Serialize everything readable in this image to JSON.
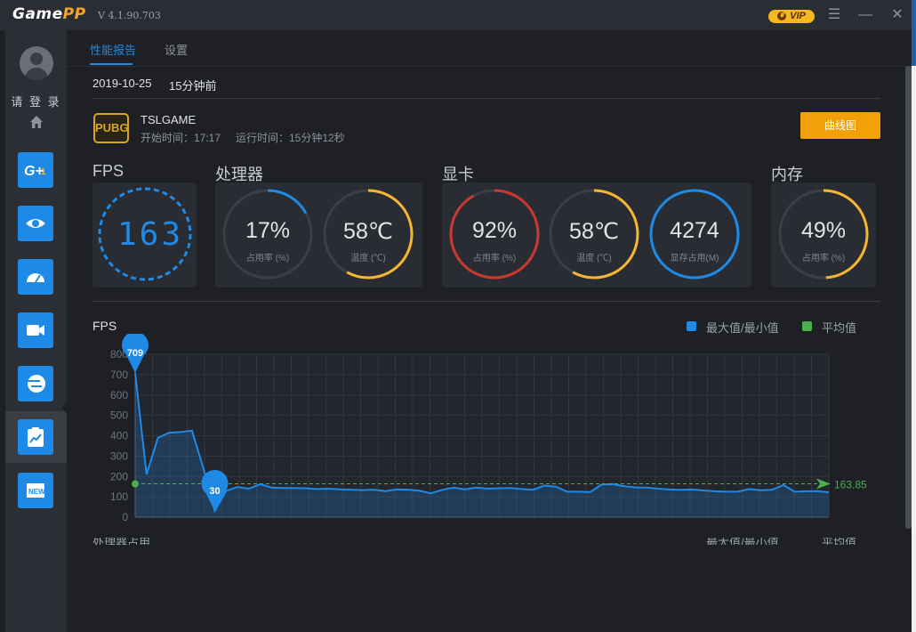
{
  "app": {
    "logo_main": "Game",
    "logo_accent": "PP",
    "version": "V 4.1.90.703",
    "vip": "VIP"
  },
  "sidebar": {
    "login": "请 登 录"
  },
  "tabs": [
    {
      "label": "性能报告"
    },
    {
      "label": "设置"
    }
  ],
  "report": {
    "date": "2019-10-25",
    "ago": "15分钟前"
  },
  "game": {
    "logo_text": "PUBG",
    "name": "TSLGAME",
    "start_time": "开始时间：17:17",
    "run_time": "运行时间：15分钟12秒",
    "curve_button": "曲线图"
  },
  "sections": {
    "fps": "FPS",
    "cpu": "处理器",
    "gpu": "显卡",
    "mem": "内存"
  },
  "fps_value": "163",
  "gauges": {
    "cpu_usage": {
      "value": "17%",
      "label": "占用率 (%)",
      "level": 0.17,
      "color": "#1f8ae6"
    },
    "cpu_temp": {
      "value": "58℃",
      "label": "温度 (℃)",
      "level": 0.58,
      "color": "#f5b731"
    },
    "gpu_usage": {
      "value": "92%",
      "label": "占用率 (%)",
      "level": 0.92,
      "color": "#c9392f"
    },
    "gpu_temp": {
      "value": "58℃",
      "label": "温度 (℃)",
      "level": 0.58,
      "color": "#f5b731"
    },
    "gpu_mem": {
      "value": "4274",
      "label": "显存占用(M)",
      "level": 1.0,
      "color": "#1f8ae6"
    },
    "mem_usage": {
      "value": "49%",
      "label": "占用率 (%)",
      "level": 0.49,
      "color": "#f5b731"
    }
  },
  "legend": {
    "maxmin": "最大值/最小值",
    "avg": "平均值",
    "maxmin_color": "#1f8ae6",
    "avg_color": "#4cae4c"
  },
  "next_section": {
    "title": "处理器占用",
    "maxmin": "最大值/最小值",
    "avg": "平均值"
  },
  "chart_data": {
    "type": "area",
    "title": "FPS",
    "ylim": [
      0,
      800
    ],
    "yticks": [
      0,
      100,
      200,
      300,
      400,
      500,
      600,
      700,
      800
    ],
    "grid": true,
    "legend": "top-right",
    "series": [
      {
        "name": "FPS",
        "values": [
          709,
          210,
          390,
          415,
          418,
          425,
          240,
          30,
          130,
          148,
          140,
          162,
          145,
          143,
          143,
          142,
          138,
          140,
          137,
          135,
          133,
          135,
          128,
          137,
          135,
          130,
          117,
          134,
          145,
          137,
          145,
          140,
          142,
          143,
          138,
          135,
          155,
          150,
          125,
          125,
          123,
          160,
          162,
          152,
          146,
          145,
          140,
          136,
          134,
          136,
          131,
          127,
          125,
          126,
          138,
          132,
          134,
          158,
          125,
          127,
          128,
          122
        ]
      }
    ],
    "average": 163.85,
    "max_label": "709",
    "min_label": "30",
    "avg_label": "163.85"
  }
}
